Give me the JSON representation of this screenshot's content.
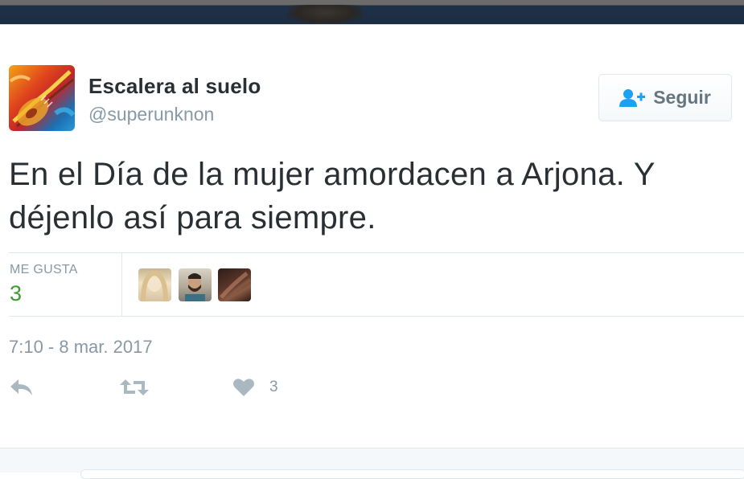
{
  "tweet": {
    "user": {
      "name": "Escalera al suelo",
      "handle": "@superunknon",
      "avatar_icon": "guitar-art-avatar"
    },
    "follow_button": {
      "label": "Seguir",
      "icon": "add-user-icon"
    },
    "text": "En el Día de la mujer amordacen a Arjona. Y déjenlo así para siempre.",
    "stats": {
      "likes_label": "ME GUSTA",
      "likes_count": "3",
      "likers": [
        "liker-1",
        "liker-2",
        "liker-3"
      ]
    },
    "timestamp": "7:10 - 8 mar. 2017",
    "actions": {
      "reply_icon": "reply-icon",
      "retweet_icon": "retweet-icon",
      "like_icon": "heart-icon",
      "like_count": "3"
    }
  },
  "colors": {
    "text": "#292f33",
    "muted": "#8899a6",
    "likes_green": "#3b9c2f",
    "border": "#e1e8ed",
    "icon_gray": "#aab8c2",
    "follow_icon": "#1da1f2"
  }
}
